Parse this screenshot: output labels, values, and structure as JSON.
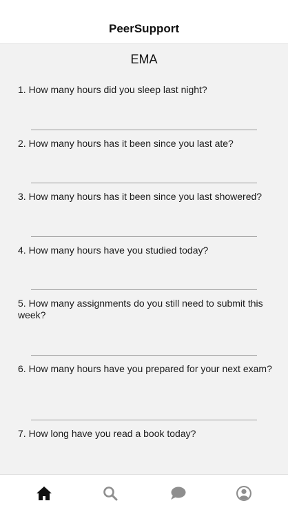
{
  "header": {
    "title": "PeerSupport"
  },
  "screen": {
    "title": "EMA"
  },
  "questions": [
    {
      "text": "1. How many hours did you sleep last night?"
    },
    {
      "text": "2. How many hours has it been since you last ate?"
    },
    {
      "text": "3. How many hours has it been since you last showered?"
    },
    {
      "text": "4. How many hours have you studied today?"
    },
    {
      "text": "5. How many assignments do you still need to submit this week?"
    },
    {
      "text": "6. How many hours have you prepared for your next exam?"
    },
    {
      "text": "7. How long have you read a book today?"
    }
  ],
  "tabbar": {
    "active_color": "#111111",
    "inactive_color": "#8e8e8e",
    "tabs": [
      {
        "icon": "home-icon",
        "active": true
      },
      {
        "icon": "search-icon",
        "active": false
      },
      {
        "icon": "chat-icon",
        "active": false
      },
      {
        "icon": "profile-icon",
        "active": false
      }
    ]
  }
}
